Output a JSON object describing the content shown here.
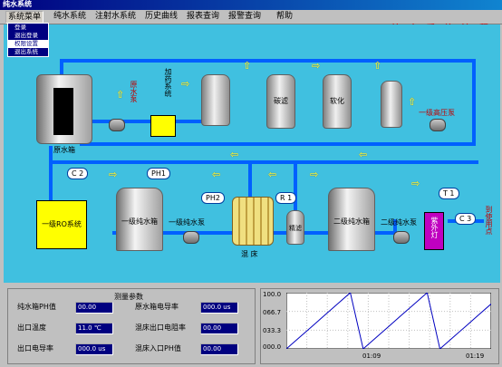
{
  "window": {
    "title": "纯水系统"
  },
  "menu": {
    "items": [
      "系统菜单",
      "纯水系统",
      "注射水系统",
      "历史曲线",
      "报表查询",
      "报警查询",
      "帮助"
    ],
    "dropdown": [
      "登录",
      "退出登录",
      "权限设置",
      "退出系统"
    ],
    "dropdown_selected": 2
  },
  "brand": "纯 水 系 统 流 程",
  "process": {
    "raw_tank": "原水箱",
    "raw_pump": "原水泵",
    "dosing": "加药系统",
    "carbon_filter": "碳滤",
    "softener": "软化",
    "booster_pump": "一级高压泵",
    "ro1": "一级RO系统",
    "tank1": "一级纯水箱",
    "pump1": "一级纯水泵",
    "mixed_bed": "混 床",
    "fine_filter": "精滤",
    "tank2": "二级纯水箱",
    "pump2": "二级纯水泵",
    "uv_lamp": "紫外灯",
    "use_point": "到使用点",
    "tags": {
      "c2": "C 2",
      "ph1": "PH1",
      "ph2": "PH2",
      "r1": "R 1",
      "t1": "T 1",
      "c3": "C 3"
    }
  },
  "measure": {
    "title": "测量参数",
    "fields": [
      {
        "label": "纯水箱PH值",
        "value": "00.00"
      },
      {
        "label": "出口温度",
        "value": "11.0",
        "unit": "℃"
      },
      {
        "label": "出口电导率",
        "value": "000.0",
        "unit": "us"
      },
      {
        "label": "原水箱电导率",
        "value": "000.0",
        "unit": "us"
      },
      {
        "label": "混床出口电阻率",
        "value": "00.00"
      },
      {
        "label": "混床入口PH值",
        "value": "00.00"
      }
    ]
  },
  "trend": {
    "y_ticks": [
      "100.0",
      "066.7",
      "033.3",
      "000.0"
    ],
    "x_ticks": [
      "01:09",
      "01:19"
    ],
    "ylim": [
      0,
      100
    ],
    "series": [
      0,
      20,
      40,
      60,
      80,
      100,
      0,
      20,
      40,
      60,
      80,
      100,
      0,
      20,
      40,
      60,
      80
    ]
  },
  "colors": {
    "background": "#40c0e0",
    "pipe": "#0060ff",
    "arrow": "#ffff40",
    "ro_box": "#ffff00",
    "uv": "#c000c0",
    "title": "#c00000"
  }
}
